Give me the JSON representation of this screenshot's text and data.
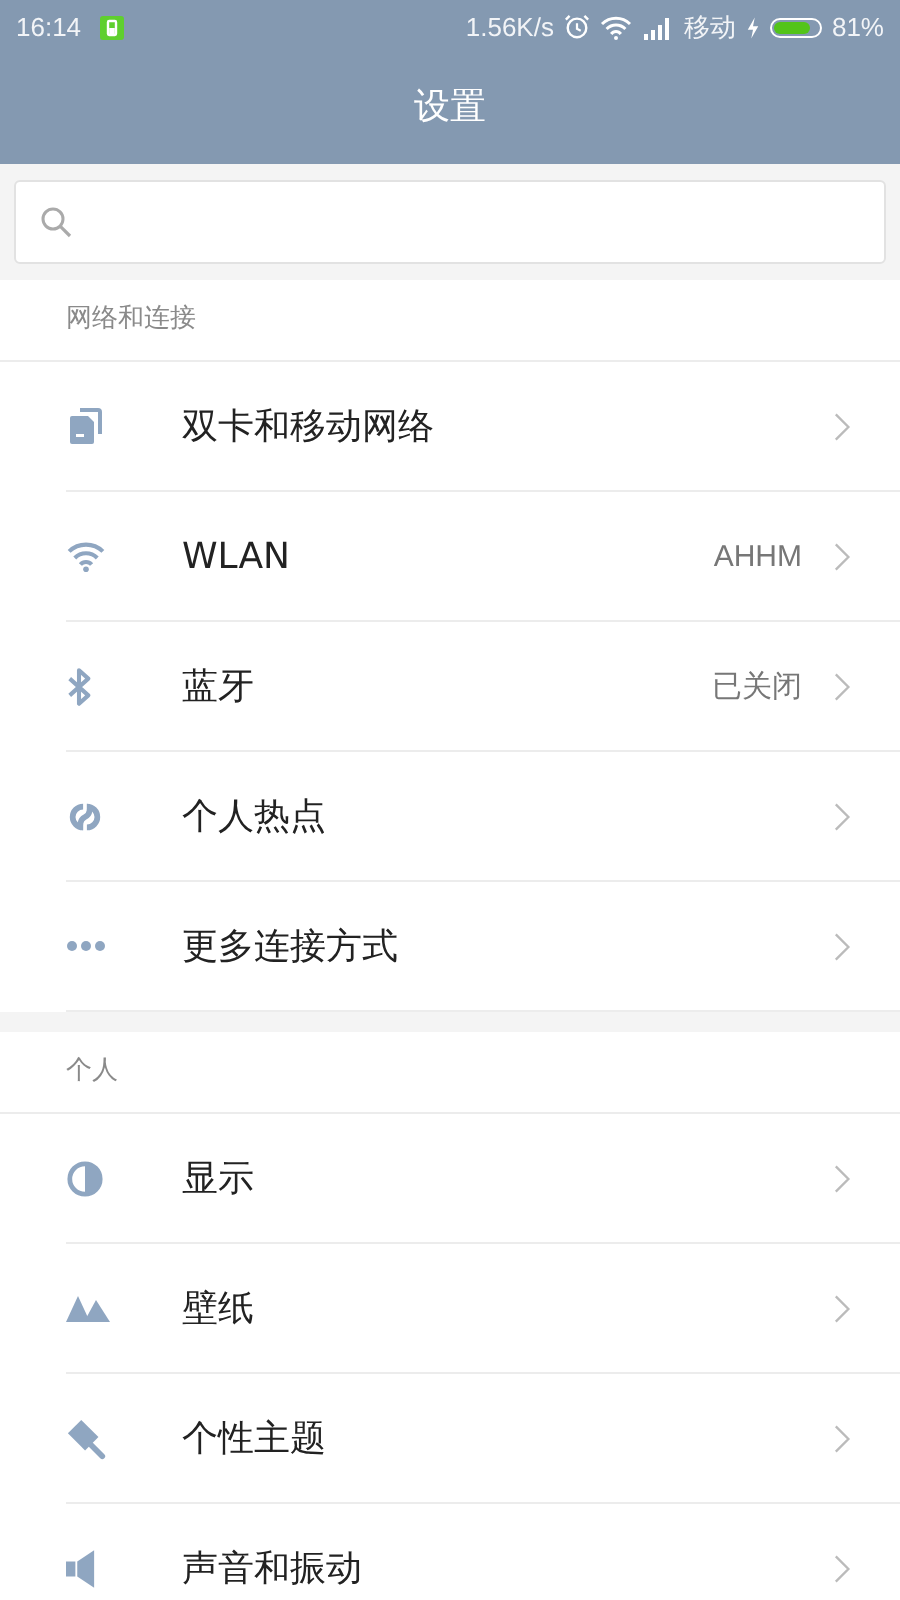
{
  "status_bar": {
    "time": "16:14",
    "speed": "1.56K/s",
    "carrier": "移动",
    "battery_text": "81%"
  },
  "title": "设置",
  "sections": [
    {
      "title": "网络和连接",
      "items": [
        {
          "kind": "sim",
          "label": "双卡和移动网络"
        },
        {
          "kind": "wifi",
          "label": "WLAN",
          "value": "AHHM"
        },
        {
          "kind": "bluetooth",
          "label": "蓝牙",
          "value": "已关闭"
        },
        {
          "kind": "hotspot",
          "label": "个人热点"
        },
        {
          "kind": "more",
          "label": "更多连接方式"
        }
      ]
    },
    {
      "title": "个人",
      "items": [
        {
          "kind": "display",
          "label": "显示"
        },
        {
          "kind": "wallpaper",
          "label": "壁纸"
        },
        {
          "kind": "theme",
          "label": "个性主题"
        },
        {
          "kind": "sound",
          "label": "声音和振动"
        }
      ]
    }
  ]
}
